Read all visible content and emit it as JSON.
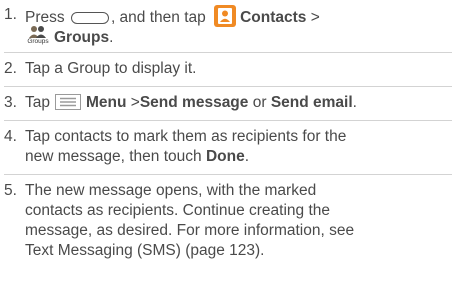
{
  "steps": [
    {
      "number": "1.",
      "text_press": "Press",
      "text_and_then_tap": ", and then tap",
      "contacts_label": "Contacts",
      "separator": ">",
      "groups_icon_label": "Groups",
      "groups_label": "Groups",
      "period": "."
    },
    {
      "number": "2.",
      "text": "Tap a Group to display it."
    },
    {
      "number": "3.",
      "text_tap": "Tap",
      "menu_label": "Menu",
      "separator": ">",
      "send_message_label": "Send message",
      "text_or": " or ",
      "send_email_label": "Send email",
      "period": "."
    },
    {
      "number": "4.",
      "line1": "Tap contacts to mark them as recipients for the",
      "line2_prefix": "new message, then touch",
      "done_label": "Done",
      "period": "."
    },
    {
      "number": "5.",
      "line1": "The new message opens, with the marked",
      "line2": "contacts as recipients. Continue creating the",
      "line3": "message, as desired. For more information, see",
      "line4": "Text Messaging (SMS) (page 123)."
    }
  ],
  "icons": {
    "home_key": "home-key-icon",
    "contacts": "contacts-icon",
    "groups": "groups-icon",
    "menu": "menu-icon"
  },
  "colors": {
    "text": "#4a4a4a",
    "contacts_icon": "#f08a24",
    "rule": "#d3d3d3"
  }
}
